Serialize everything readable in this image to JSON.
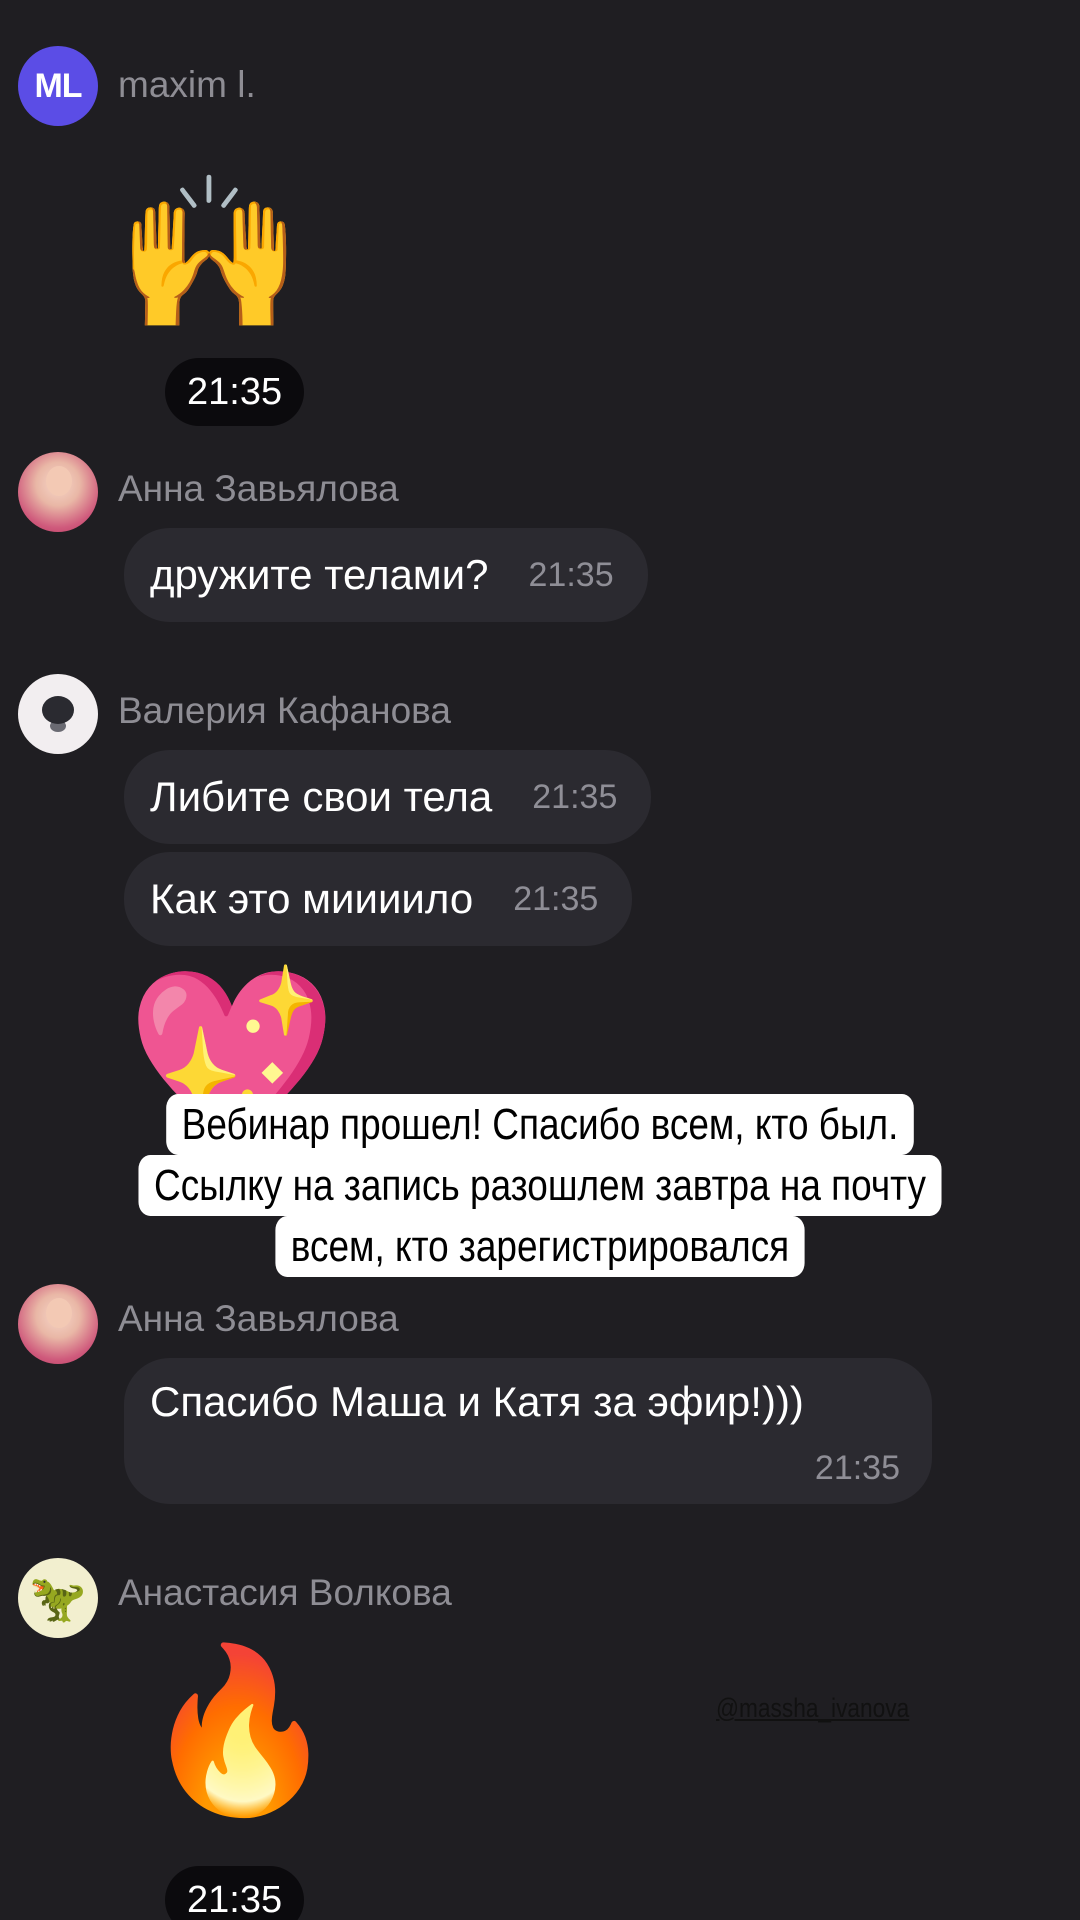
{
  "messages": [
    {
      "author": "maxim l.",
      "avatar_initials": "ML",
      "emoji_name": "raising-hands",
      "emoji": "🙌",
      "time": "21:35"
    },
    {
      "author": "Анна Завьялова",
      "text": "дружите телами?",
      "time": "21:35"
    },
    {
      "author": "Валерия Кафанова",
      "text": "Либите свои тела",
      "time": "21:35"
    },
    {
      "author": "Валерия Кафанова",
      "text": "Как это миииило",
      "time": "21:35"
    },
    {
      "author": "Валерия Кафанова",
      "emoji_name": "sparkling-heart",
      "emoji": "💖"
    },
    {
      "author": "Анна Завьялова",
      "text": "Спасибо Маша и Катя за эфир!)))",
      "time": "21:35"
    },
    {
      "author": "Анастасия Волкова",
      "avatar_icon": "dinosaur",
      "avatar_emoji": "🦖",
      "emoji_name": "fire",
      "emoji": "🔥",
      "time": "21:35"
    }
  ],
  "story_caption": {
    "lines": [
      "Вебинар прошел! Спасибо всем, кто был.",
      "Ссылку на запись разошлем завтра на почту",
      "всем, кто зарегистрировался"
    ]
  },
  "mention": "@massha_ivanova",
  "colors": {
    "background": "#1f1e22",
    "bubble": "#2b2a30",
    "author_name": "#8e8d94",
    "avatar_ml": "#5b4de6",
    "time_pill": "#0b0a0d"
  }
}
